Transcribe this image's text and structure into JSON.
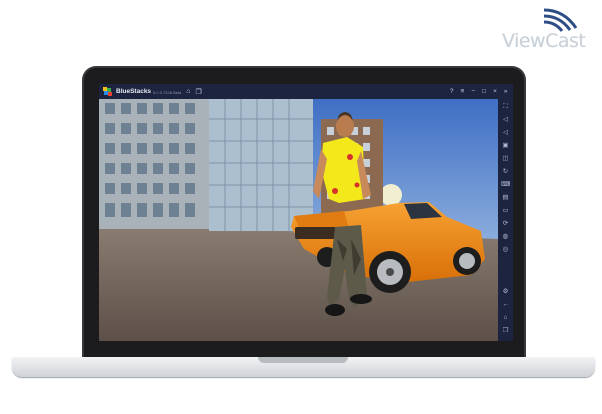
{
  "watermark": {
    "text": "ViewCast"
  },
  "window": {
    "app_name": "BlueStacks",
    "version": "5.0.0.7228 Beta",
    "left_icons": [
      "home-icon",
      "multi-instance-icon"
    ],
    "right_icons": [
      "help-icon",
      "menu-icon",
      "minimize-icon",
      "restore-icon",
      "close-icon",
      "collapse-sidebar-icon"
    ]
  },
  "sidebar": {
    "icons": [
      "fullscreen-icon",
      "volume-up-icon",
      "volume-down-icon",
      "screen-record-icon",
      "screenshot-icon",
      "rotate-icon",
      "macro-icon",
      "multi-instance-manager-icon",
      "folder-icon",
      "sync-icon",
      "eco-mode-icon",
      "shake-icon",
      "settings-icon",
      "back-icon",
      "home-icon",
      "recent-apps-icon"
    ]
  },
  "colors": {
    "titlebar": "#1d2440",
    "sky": "#4a79c9",
    "car": "#f08a14",
    "shirt": "#f2e81a"
  }
}
